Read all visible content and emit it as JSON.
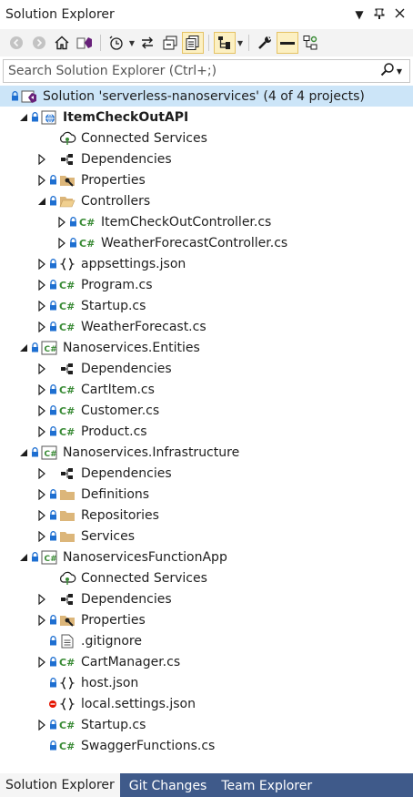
{
  "window": {
    "title": "Solution Explorer"
  },
  "search": {
    "placeholder": "Search Solution Explorer (Ctrl+;)"
  },
  "tree": [
    {
      "level": 0,
      "label": "Solution 'serverless-nanoservices' (4 of 4 projects)",
      "icon": "solution-icon",
      "arrow": "none",
      "overlay": "lock",
      "selected": true
    },
    {
      "level": 1,
      "label": "ItemCheckOutAPI",
      "icon": "web-project-icon",
      "arrow": "expanded",
      "overlay": "lock",
      "bold": true
    },
    {
      "level": 2,
      "label": "Connected Services",
      "icon": "connected-services-icon",
      "arrow": "none",
      "overlay": "none"
    },
    {
      "level": 2,
      "label": "Dependencies",
      "icon": "dependencies-icon",
      "arrow": "collapsed",
      "overlay": "none"
    },
    {
      "level": 2,
      "label": "Properties",
      "icon": "properties-folder-icon",
      "arrow": "collapsed",
      "overlay": "lock"
    },
    {
      "level": 2,
      "label": "Controllers",
      "icon": "folder-open-icon",
      "arrow": "expanded",
      "overlay": "lock"
    },
    {
      "level": 3,
      "label": "ItemCheckOutController.cs",
      "icon": "csharp-file-icon",
      "arrow": "collapsed",
      "overlay": "lock"
    },
    {
      "level": 3,
      "label": "WeatherForecastController.cs",
      "icon": "csharp-file-icon",
      "arrow": "collapsed",
      "overlay": "lock"
    },
    {
      "level": 2,
      "label": "appsettings.json",
      "icon": "json-file-icon",
      "arrow": "collapsed",
      "overlay": "lock"
    },
    {
      "level": 2,
      "label": "Program.cs",
      "icon": "csharp-file-icon",
      "arrow": "collapsed",
      "overlay": "lock"
    },
    {
      "level": 2,
      "label": "Startup.cs",
      "icon": "csharp-file-icon",
      "arrow": "collapsed",
      "overlay": "lock"
    },
    {
      "level": 2,
      "label": "WeatherForecast.cs",
      "icon": "csharp-file-icon",
      "arrow": "collapsed",
      "overlay": "lock"
    },
    {
      "level": 1,
      "label": "Nanoservices.Entities",
      "icon": "csharp-project-icon",
      "arrow": "expanded",
      "overlay": "lock"
    },
    {
      "level": 2,
      "label": "Dependencies",
      "icon": "dependencies-icon",
      "arrow": "collapsed",
      "overlay": "none"
    },
    {
      "level": 2,
      "label": "CartItem.cs",
      "icon": "csharp-file-icon",
      "arrow": "collapsed",
      "overlay": "lock"
    },
    {
      "level": 2,
      "label": "Customer.cs",
      "icon": "csharp-file-icon",
      "arrow": "collapsed",
      "overlay": "lock"
    },
    {
      "level": 2,
      "label": "Product.cs",
      "icon": "csharp-file-icon",
      "arrow": "collapsed",
      "overlay": "lock"
    },
    {
      "level": 1,
      "label": "Nanoservices.Infrastructure",
      "icon": "csharp-project-icon",
      "arrow": "expanded",
      "overlay": "lock"
    },
    {
      "level": 2,
      "label": "Dependencies",
      "icon": "dependencies-icon",
      "arrow": "collapsed",
      "overlay": "none"
    },
    {
      "level": 2,
      "label": "Definitions",
      "icon": "folder-icon",
      "arrow": "collapsed",
      "overlay": "lock"
    },
    {
      "level": 2,
      "label": "Repositories",
      "icon": "folder-icon",
      "arrow": "collapsed",
      "overlay": "lock"
    },
    {
      "level": 2,
      "label": "Services",
      "icon": "folder-icon",
      "arrow": "collapsed",
      "overlay": "lock"
    },
    {
      "level": 1,
      "label": "NanoservicesFunctionApp",
      "icon": "csharp-project-icon",
      "arrow": "expanded",
      "overlay": "lock"
    },
    {
      "level": 2,
      "label": "Connected Services",
      "icon": "connected-services-icon",
      "arrow": "none",
      "overlay": "none"
    },
    {
      "level": 2,
      "label": "Dependencies",
      "icon": "dependencies-icon",
      "arrow": "collapsed",
      "overlay": "none"
    },
    {
      "level": 2,
      "label": "Properties",
      "icon": "properties-folder-icon",
      "arrow": "collapsed",
      "overlay": "lock"
    },
    {
      "level": 2,
      "label": ".gitignore",
      "icon": "text-file-icon",
      "arrow": "none",
      "overlay": "lock"
    },
    {
      "level": 2,
      "label": "CartManager.cs",
      "icon": "csharp-file-icon",
      "arrow": "collapsed",
      "overlay": "lock"
    },
    {
      "level": 2,
      "label": "host.json",
      "icon": "json-file-icon",
      "arrow": "none",
      "overlay": "lock"
    },
    {
      "level": 2,
      "label": "local.settings.json",
      "icon": "json-file-icon",
      "arrow": "none",
      "overlay": "excluded"
    },
    {
      "level": 2,
      "label": "Startup.cs",
      "icon": "csharp-file-icon",
      "arrow": "collapsed",
      "overlay": "lock"
    },
    {
      "level": 2,
      "label": "SwaggerFunctions.cs",
      "icon": "csharp-file-icon",
      "arrow": "none",
      "overlay": "lock"
    }
  ],
  "tabs": [
    {
      "label": "Solution Explorer",
      "active": true
    },
    {
      "label": "Git Changes",
      "active": false
    },
    {
      "label": "Team Explorer",
      "active": false
    }
  ],
  "colors": {
    "selection": "#cce5f8",
    "tab_bar": "#3f5a8a",
    "lock_blue": "#1e6fd1",
    "csharp_green": "#388a34",
    "folder_tan": "#dcb67a",
    "excluded_red": "#e51400"
  }
}
